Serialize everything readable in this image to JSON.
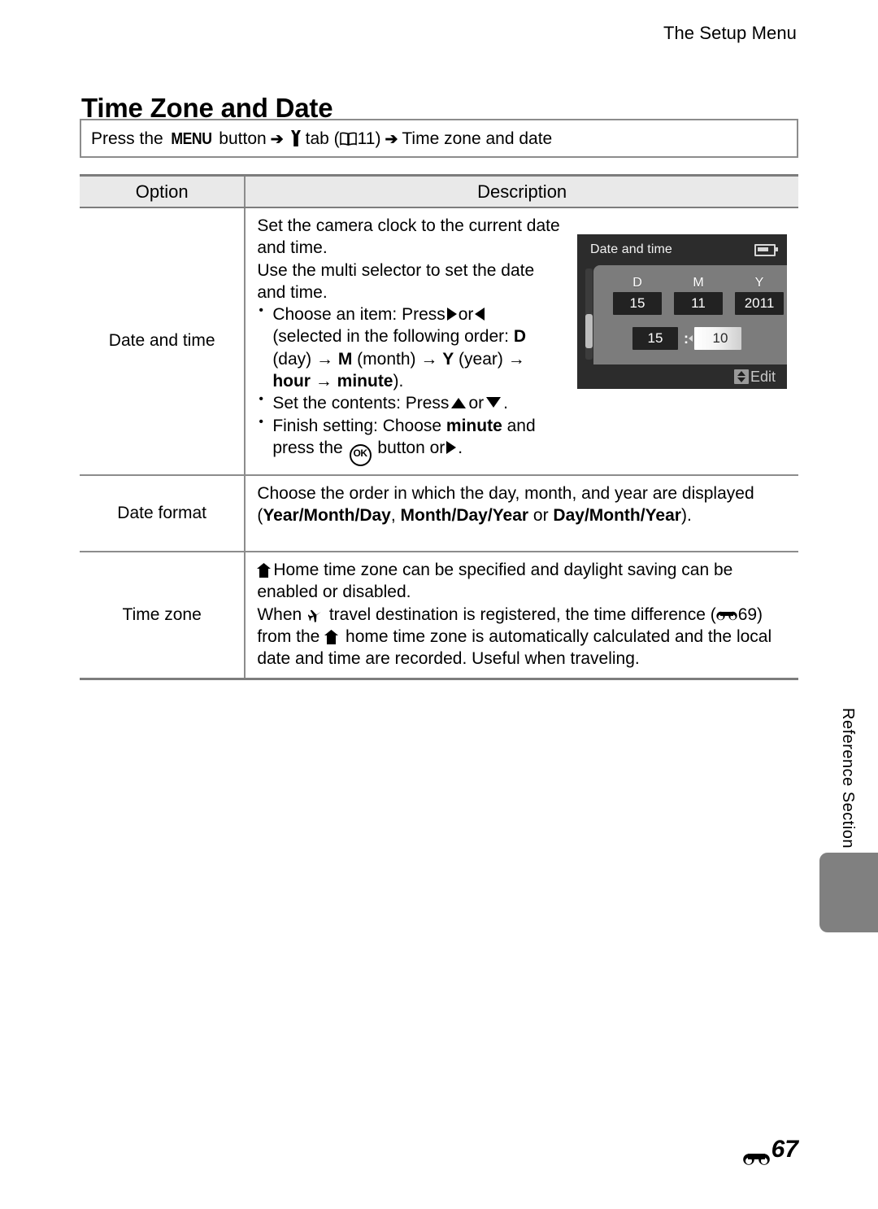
{
  "running_head": "The Setup Menu",
  "page_title": "Time Zone and Date",
  "nav_bar": {
    "press_the": "Press the",
    "menu_label": "MENU",
    "button_word": "button",
    "arrow": "➔",
    "setup_tab_icon": "wrench-icon",
    "tab_word": "tab",
    "ref_open": "(",
    "book_icon": "book-icon",
    "page_ref": "11)",
    "arrow2": "➔",
    "destination": "Time zone and date"
  },
  "table": {
    "headers": [
      "Option",
      "Description"
    ],
    "rows": [
      {
        "option": "Date and time",
        "intro": [
          "Set the camera clock to the current date and time.",
          "Use the multi selector to set the date",
          "and time."
        ],
        "bullets": [
          {
            "parts": [
              {
                "t": "Choose an item: Press ",
                "b": false
              },
              {
                "t": "right-triangle-icon",
                "b": false,
                "icon": true
              },
              {
                "t": " or ",
                "b": false
              },
              {
                "t": "left-triangle-icon",
                "b": false,
                "icon": true
              },
              {
                "t": " (selected in the following order: ",
                "b": false
              },
              {
                "t": "D",
                "b": true
              },
              {
                "t": " (day) → ",
                "b": false
              },
              {
                "t": "M",
                "b": true
              },
              {
                "t": " (month) → ",
                "b": false
              },
              {
                "t": "Y",
                "b": true
              },
              {
                "t": " (year) → ",
                "b": false
              },
              {
                "t": "hour",
                "b": true
              },
              {
                "t": " → ",
                "b": false
              },
              {
                "t": "minute",
                "b": true
              },
              {
                "t": ").",
                "b": false
              }
            ]
          },
          {
            "parts": [
              {
                "t": "Set the contents: Press ",
                "b": false
              },
              {
                "t": "up-triangle-icon",
                "b": false,
                "icon": true
              },
              {
                "t": " or ",
                "b": false
              },
              {
                "t": "down-triangle-icon",
                "b": false,
                "icon": true
              },
              {
                "t": ".",
                "b": false
              }
            ]
          },
          {
            "parts": [
              {
                "t": "Finish setting: Choose ",
                "b": false
              },
              {
                "t": "minute",
                "b": true
              },
              {
                "t": " and press the ",
                "b": false
              },
              {
                "t": "ok-button-icon",
                "b": false,
                "icon": true
              },
              {
                "t": " button or ",
                "b": false
              },
              {
                "t": "right-triangle-icon",
                "b": false,
                "icon": true
              },
              {
                "t": ".",
                "b": false
              }
            ]
          }
        ]
      },
      {
        "option": "Date format",
        "line1": "Choose the order in which the day, month, and year are displayed",
        "line2_open": "(",
        "formats": [
          "Year/Month/Day",
          "Month/Day/Year",
          "Day/Month/Year"
        ],
        "line2_sep1": ", ",
        "line2_sep2": " or ",
        "line2_close": ")."
      },
      {
        "option": "Time zone",
        "line1": "Home time zone can be specified and daylight saving can be",
        "line2": "enabled or disabled.",
        "line3a": "When ",
        "line3b": " travel destination is registered, the time difference (",
        "line3_ref": "69)",
        "line4a": "from the ",
        "line4b": " home time zone is automatically calculated and the local",
        "line5": "date and time are recorded. Useful when traveling."
      }
    ]
  },
  "lcd": {
    "title": "Date and time",
    "battery_icon": "battery-icon",
    "date_fields": [
      {
        "letter": "D",
        "value": "15"
      },
      {
        "letter": "M",
        "value": "11"
      },
      {
        "letter": "Y",
        "value": "2011"
      }
    ],
    "hour": "15",
    "colon": ":",
    "minute": "10",
    "footer_label": "Edit",
    "footer_icon": "up-down-arrow-icon"
  },
  "side_label": "Reference Section",
  "folio": {
    "icon": "reference-section-icon",
    "number": "67"
  }
}
